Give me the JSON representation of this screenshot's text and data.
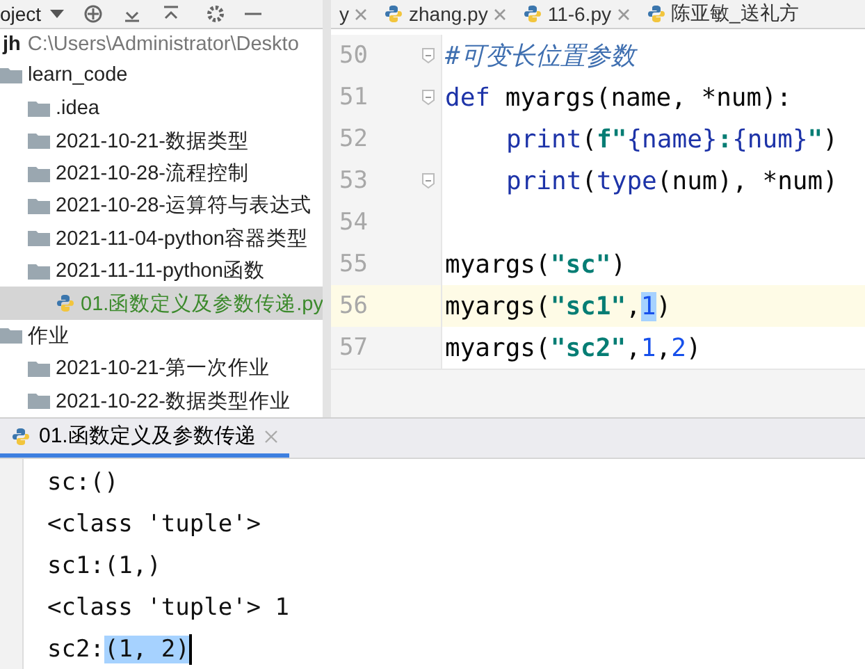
{
  "toolbar": {
    "view_label": "oject",
    "tabs": [
      {
        "label": "y",
        "closable": true,
        "icon": false
      },
      {
        "label": "zhang.py",
        "closable": true,
        "icon": true
      },
      {
        "label": "11-6.py",
        "closable": true,
        "icon": true
      },
      {
        "label": "陈亚敏_送礼方",
        "closable": false,
        "icon": true
      }
    ]
  },
  "project": {
    "root": "jh",
    "path": "C:\\Users\\Administrator\\Deskto",
    "items": [
      {
        "name": "learn_code",
        "kind": "folder",
        "selected": false,
        "children": [
          {
            "name": ".idea",
            "kind": "folder",
            "selected": false
          },
          {
            "name": "2021-10-21-数据类型",
            "kind": "folder",
            "selected": false
          },
          {
            "name": "2021-10-28-流程控制",
            "kind": "folder",
            "selected": false
          },
          {
            "name": "2021-10-28-运算符与表达式",
            "kind": "folder",
            "selected": false
          },
          {
            "name": "2021-11-04-python容器类型",
            "kind": "folder",
            "selected": false
          },
          {
            "name": "2021-11-11-python函数",
            "kind": "folder",
            "selected": false,
            "children": [
              {
                "name": "01.函数定义及参数传递.py",
                "kind": "python",
                "selected": true
              }
            ]
          }
        ]
      },
      {
        "name": "作业",
        "kind": "folder",
        "selected": false,
        "children": [
          {
            "name": "2021-10-21-第一次作业",
            "kind": "folder",
            "selected": false
          },
          {
            "name": "2021-10-22-数据类型作业",
            "kind": "folder",
            "selected": false
          }
        ]
      }
    ]
  },
  "editor": {
    "lines": [
      {
        "number": "50",
        "fold": true,
        "current": false,
        "segments": [
          {
            "text": "#可变长位置参数",
            "kind": "comment",
            "highlighted": false
          }
        ]
      },
      {
        "number": "51",
        "fold": true,
        "current": false,
        "segments": [
          {
            "text": "def ",
            "kind": "keyword",
            "highlighted": false
          },
          {
            "text": "myargs(name, *num):",
            "kind": "plain",
            "highlighted": false
          }
        ],
        "children": [
          {
            "number": "52",
            "fold": false,
            "current": false,
            "segments": [
              {
                "text": "print",
                "kind": "builtin",
                "highlighted": false
              },
              {
                "text": "(",
                "kind": "plain",
                "highlighted": false
              },
              {
                "text": "f\"",
                "kind": "string",
                "highlighted": false
              },
              {
                "text": "{name}",
                "kind": "interp",
                "highlighted": false
              },
              {
                "text": ":",
                "kind": "string",
                "highlighted": false
              },
              {
                "text": "{num}",
                "kind": "interp",
                "highlighted": false
              },
              {
                "text": "\"",
                "kind": "string",
                "highlighted": false
              },
              {
                "text": ")",
                "kind": "plain",
                "highlighted": false
              }
            ]
          },
          {
            "number": "53",
            "fold": true,
            "current": false,
            "segments": [
              {
                "text": "print",
                "kind": "builtin",
                "highlighted": false
              },
              {
                "text": "(",
                "kind": "plain",
                "highlighted": false
              },
              {
                "text": "type",
                "kind": "builtin",
                "highlighted": false
              },
              {
                "text": "(num), *num)",
                "kind": "plain",
                "highlighted": false
              }
            ]
          }
        ]
      },
      {
        "number": "54",
        "fold": false,
        "current": false
      },
      {
        "number": "55",
        "fold": false,
        "current": false,
        "segments": [
          {
            "text": "myargs(",
            "kind": "plain",
            "highlighted": false
          },
          {
            "text": "\"sc\"",
            "kind": "string",
            "highlighted": false
          },
          {
            "text": ")",
            "kind": "plain",
            "highlighted": false
          }
        ]
      },
      {
        "number": "56",
        "fold": false,
        "current": true,
        "segments": [
          {
            "text": "myargs(",
            "kind": "plain",
            "highlighted": false
          },
          {
            "text": "\"sc1\"",
            "kind": "string",
            "highlighted": false
          },
          {
            "text": ",",
            "kind": "plain",
            "highlighted": false
          },
          {
            "text": "1",
            "kind": "number",
            "highlighted": true
          },
          {
            "text": ")",
            "kind": "plain",
            "highlighted": false
          }
        ]
      },
      {
        "number": "57",
        "fold": false,
        "current": false,
        "segments": [
          {
            "text": "myargs(",
            "kind": "plain",
            "highlighted": false
          },
          {
            "text": "\"sc2\"",
            "kind": "string",
            "highlighted": false
          },
          {
            "text": ",",
            "kind": "plain",
            "highlighted": false
          },
          {
            "text": "1",
            "kind": "number",
            "highlighted": false
          },
          {
            "text": ",",
            "kind": "plain",
            "highlighted": false
          },
          {
            "text": "2",
            "kind": "number",
            "highlighted": false
          },
          {
            "text": ")",
            "kind": "plain",
            "highlighted": false
          }
        ]
      }
    ]
  },
  "run_panel": {
    "tab": {
      "label": "01.函数定义及参数传递",
      "selected": true
    },
    "output": [
      [
        {
          "text": "sc:()",
          "highlighted": false
        }
      ],
      [
        {
          "text": "<class 'tuple'>",
          "highlighted": false
        }
      ],
      [
        {
          "text": "sc1:(1,)",
          "highlighted": false
        }
      ],
      [
        {
          "text": "<class 'tuple'> 1",
          "highlighted": false
        }
      ],
      [
        {
          "text": "sc2:",
          "highlighted": false
        },
        {
          "text": "(1, 2)",
          "highlighted": true
        }
      ]
    ]
  }
}
